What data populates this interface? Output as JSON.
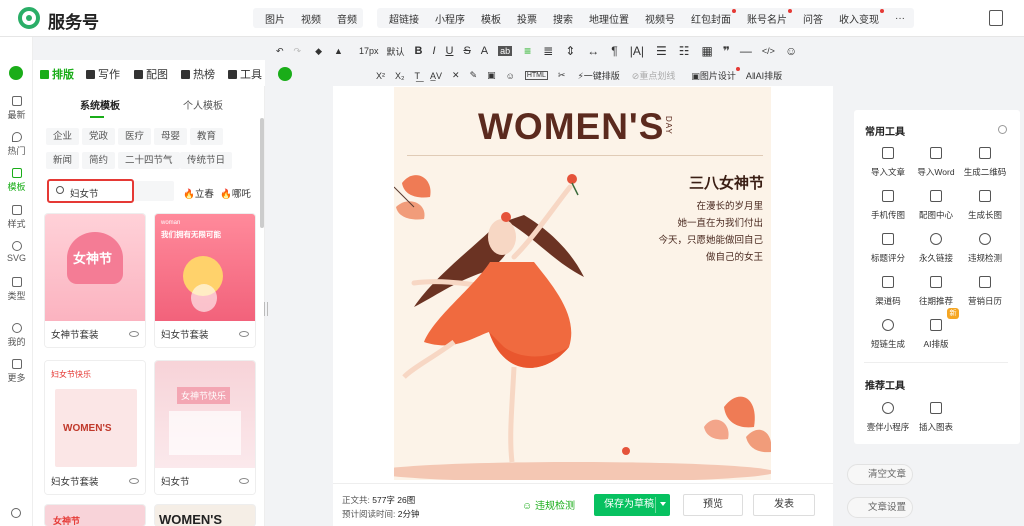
{
  "app": {
    "title": "服务号"
  },
  "top_menu": {
    "group1": [
      "图片",
      "视频",
      "音频"
    ],
    "group2": [
      "超链接",
      "小程序",
      "模板",
      "投票",
      "搜索",
      "地理位置",
      "视频号",
      "红包封面",
      "账号名片",
      "问答",
      "收入变现",
      "···"
    ]
  },
  "toolbar": {
    "font_size": "17px",
    "font_default": "默认",
    "row1_icons": [
      "undo-icon",
      "redo-icon",
      "clear-format-icon",
      "format-painter-icon",
      "bold-icon",
      "italic-icon",
      "underline-icon",
      "strikethrough-icon",
      "font-color-icon",
      "background-color-icon",
      "align-icon",
      "indent-icon",
      "line-height-icon",
      "letter-spacing-icon",
      "list-icon",
      "table-icon",
      "quote-icon",
      "divider-icon",
      "code-icon",
      "emoji-icon"
    ],
    "one_click_layout": "一键排版",
    "redo_layout": "重点划线",
    "image_design": "图片设计",
    "ai_layout": "AI排版"
  },
  "editor_tabs": [
    "排版",
    "写作",
    "配图",
    "热榜",
    "工具"
  ],
  "rail": [
    "最新",
    "热门",
    "模板",
    "样式",
    "SVG",
    "类型",
    "我的",
    "更多"
  ],
  "template_panel": {
    "tabs": [
      "系统模板",
      "个人模板"
    ],
    "chips_row1": [
      "企业",
      "党政",
      "医疗",
      "母婴",
      "教育"
    ],
    "chips_row2": [
      "新闻",
      "简约",
      "二十四节气",
      "传统节日"
    ],
    "search_value": "妇女节",
    "hot_tags": [
      "立春",
      "哪吒"
    ],
    "cards": [
      {
        "name": "女神节套装",
        "thumb_title": "女神节"
      },
      {
        "name": "妇女节套装",
        "thumb_title": "我们拥有无限可能"
      },
      {
        "name": "妇女节套装",
        "thumb_title": "妇女节快乐"
      },
      {
        "name": "妇女节",
        "thumb_title": "女神节快乐"
      }
    ],
    "partial_cards": [
      "女神节",
      "WOMEN'S"
    ]
  },
  "poster": {
    "title": "WOMEN'S",
    "day": "DAY",
    "heading": "三八女神节",
    "lines": [
      "在漫长的岁月里",
      "她一直在为我们付出",
      "今天，只愿她能做回自己",
      "做自己的女王"
    ]
  },
  "bottom": {
    "word_count_label": "正文共:",
    "word_count_value": "577字 26图",
    "read_time_label": "预计阅读时间:",
    "read_time_value": "2分钟",
    "check_label": "违规检测",
    "save_label": "保存为草稿",
    "preview_label": "预览",
    "publish_label": "发表"
  },
  "right_panel": {
    "common_tools_title": "常用工具",
    "common_tools": [
      "导入文章",
      "导入Word",
      "生成二维码",
      "手机传图",
      "配图中心",
      "生成长图",
      "标题评分",
      "永久链接",
      "违规检测",
      "渠道码",
      "往期推荐",
      "营销日历",
      "短链生成",
      "AI排版"
    ],
    "recommended_title": "推荐工具",
    "recommended_tools": [
      "壹伴小程序",
      "插入图表"
    ],
    "new_badge": "新",
    "clear_label": "清空文章",
    "settings_label": "文章设置"
  }
}
